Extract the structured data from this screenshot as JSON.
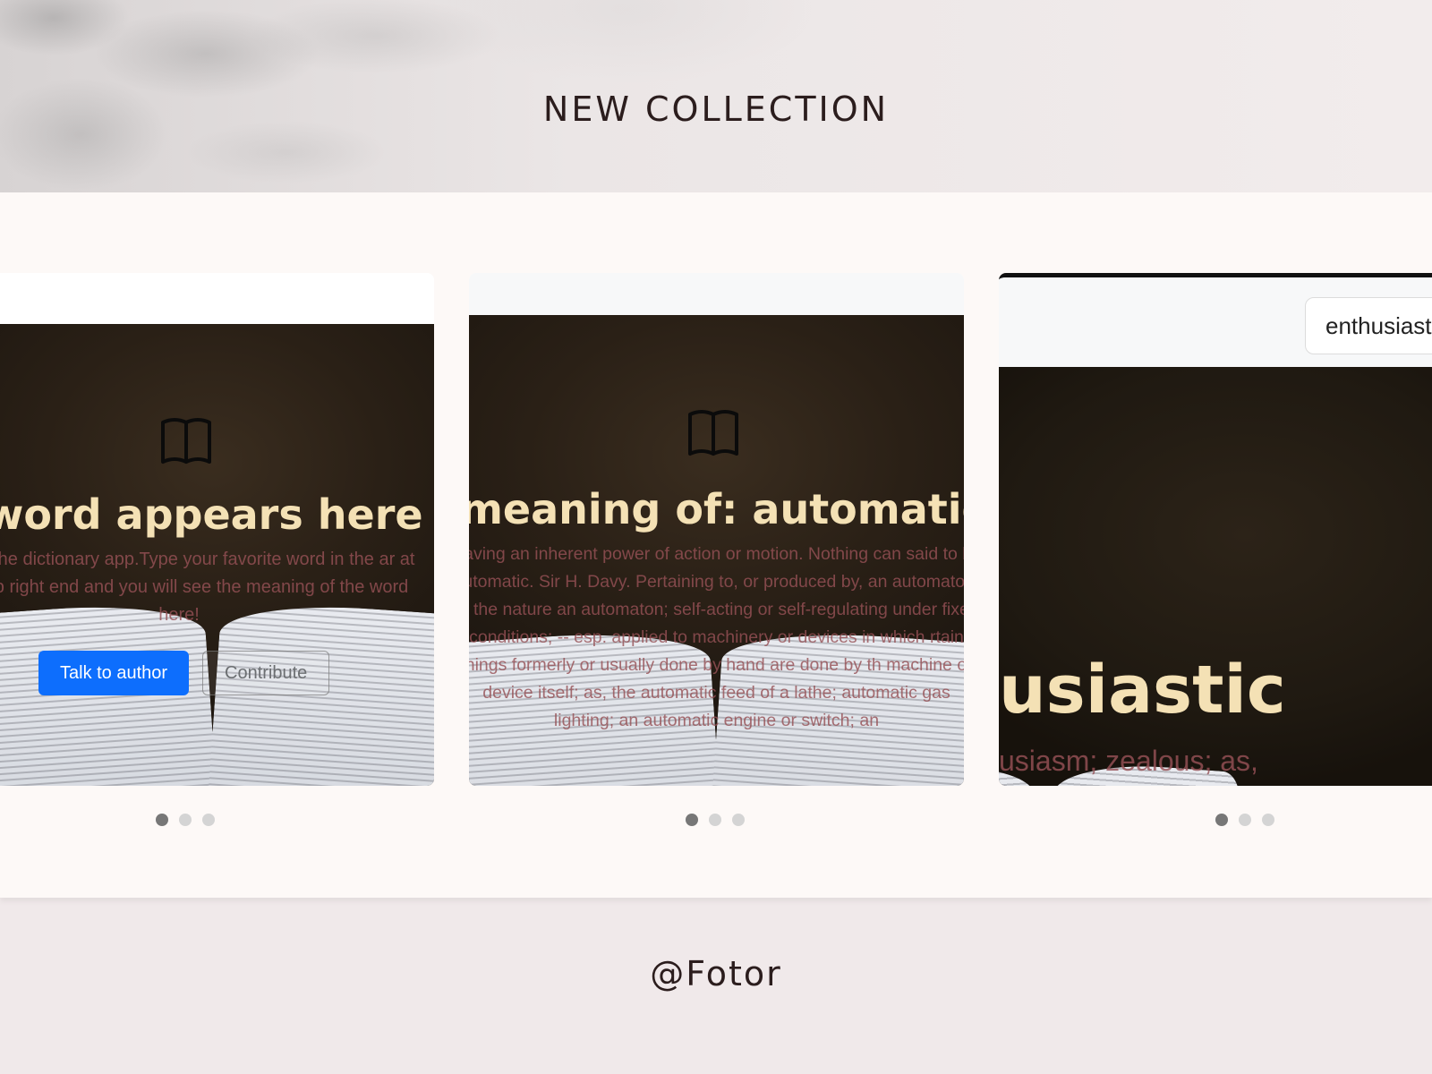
{
  "header": {
    "title": "NEW COLLECTION"
  },
  "cards": [
    {
      "title": "ur word appears here",
      "text": "me to the dictionary app.Type your favorite word in the ar at the top right end and you will see the meaning of the word here!",
      "primary_button": "Talk to author",
      "secondary_button": "Contribute"
    },
    {
      "title": "meaning of: automatic",
      "text": "Having an inherent power of action or motion. Nothing can said to be automatic. Sir H. Davy. Pertaining to, or produced by, an automaton; of the nature an automaton; self-acting or self-regulating under fixed conditions; -- esp. applied to machinery or devices in which rtain things formerly or usually done by hand are done by th machine or device itself; as, the automatic feed of a lathe; automatic gas lighting; an automatic engine or switch; an"
    },
    {
      "search_value": "enthusiast",
      "title": "usiastic",
      "text": "usiasm; zealous; as,"
    }
  ],
  "carousel": {
    "dot_count": 3,
    "active_index": 0
  },
  "footer": {
    "text": "@Fotor"
  },
  "colors": {
    "title_cream": "#f4e1b5",
    "body_text": "#9a5a5f",
    "primary_blue": "#0d6efd",
    "panel": "#fdf9f7",
    "page_bg": "#f0e9ea"
  }
}
